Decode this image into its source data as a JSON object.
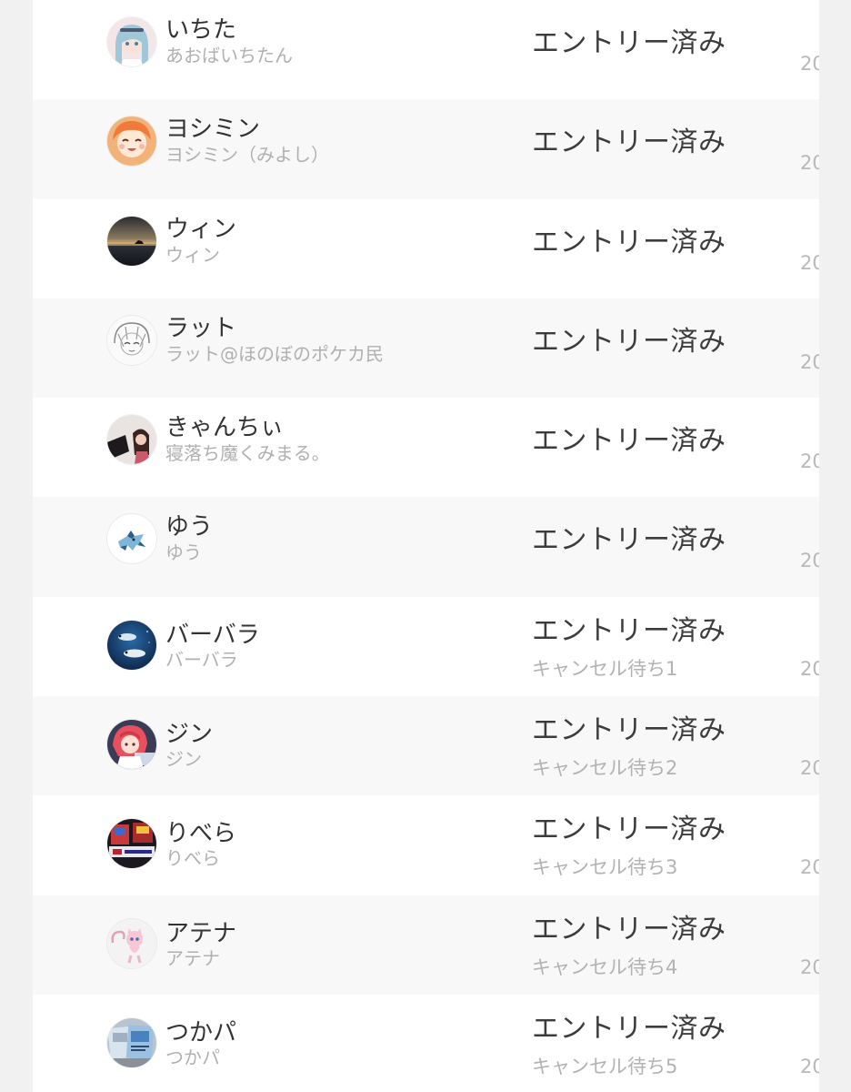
{
  "entries": [
    {
      "name": "いちた",
      "subname": "あおばいちたん",
      "status": "エントリー済み",
      "waitlist": "",
      "date_fragment": "20",
      "avatar_icon": "anime-girl-avatar-icon"
    },
    {
      "name": "ヨシミン",
      "subname": "ヨシミン（みよし）",
      "status": "エントリー済み",
      "waitlist": "",
      "date_fragment": "20",
      "avatar_icon": "anime-girl-avatar-icon"
    },
    {
      "name": "ウィン",
      "subname": "ウィン",
      "status": "エントリー済み",
      "waitlist": "",
      "date_fragment": "20",
      "avatar_icon": "sunset-sea-avatar-icon"
    },
    {
      "name": "ラット",
      "subname": "ラット@ほのぼのポケカ民",
      "status": "エントリー済み",
      "waitlist": "",
      "date_fragment": "20",
      "avatar_icon": "sketch-girl-avatar-icon"
    },
    {
      "name": "きゃんちぃ",
      "subname": "寝落ち魔くみまる。",
      "status": "エントリー済み",
      "waitlist": "",
      "date_fragment": "20",
      "avatar_icon": "photo-avatar-icon"
    },
    {
      "name": "ゆう",
      "subname": "ゆう",
      "status": "エントリー済み",
      "waitlist": "",
      "date_fragment": "20",
      "avatar_icon": "glaceon-avatar-icon"
    },
    {
      "name": "バーバラ",
      "subname": "バーバラ",
      "status": "エントリー済み",
      "waitlist": "キャンセル待ち1",
      "date_fragment": "20",
      "avatar_icon": "fish-avatar-icon"
    },
    {
      "name": "ジン",
      "subname": "ジン",
      "status": "エントリー済み",
      "waitlist": "キャンセル待ち2",
      "date_fragment": "20",
      "avatar_icon": "anime-girl-avatar-icon"
    },
    {
      "name": "りべら",
      "subname": "りべら",
      "status": "エントリー済み",
      "waitlist": "キャンセル待ち3",
      "date_fragment": "20",
      "avatar_icon": "qualifier-cards-avatar-icon"
    },
    {
      "name": "アテナ",
      "subname": "アテナ",
      "status": "エントリー済み",
      "waitlist": "キャンセル待ち4",
      "date_fragment": "20",
      "avatar_icon": "mew-avatar-icon"
    },
    {
      "name": "つかパ",
      "subname": "つかパ",
      "status": "エントリー済み",
      "waitlist": "キャンセル待ち5",
      "date_fragment": "20",
      "avatar_icon": "cards-avatar-icon"
    }
  ],
  "colors": {
    "page_background": "#f1f1f1",
    "row_odd": "#ffffff",
    "row_even": "#f8f8f8",
    "name_text": "#333333",
    "sub_text": "#b0b0b0",
    "status_text": "#3c3c3c"
  }
}
